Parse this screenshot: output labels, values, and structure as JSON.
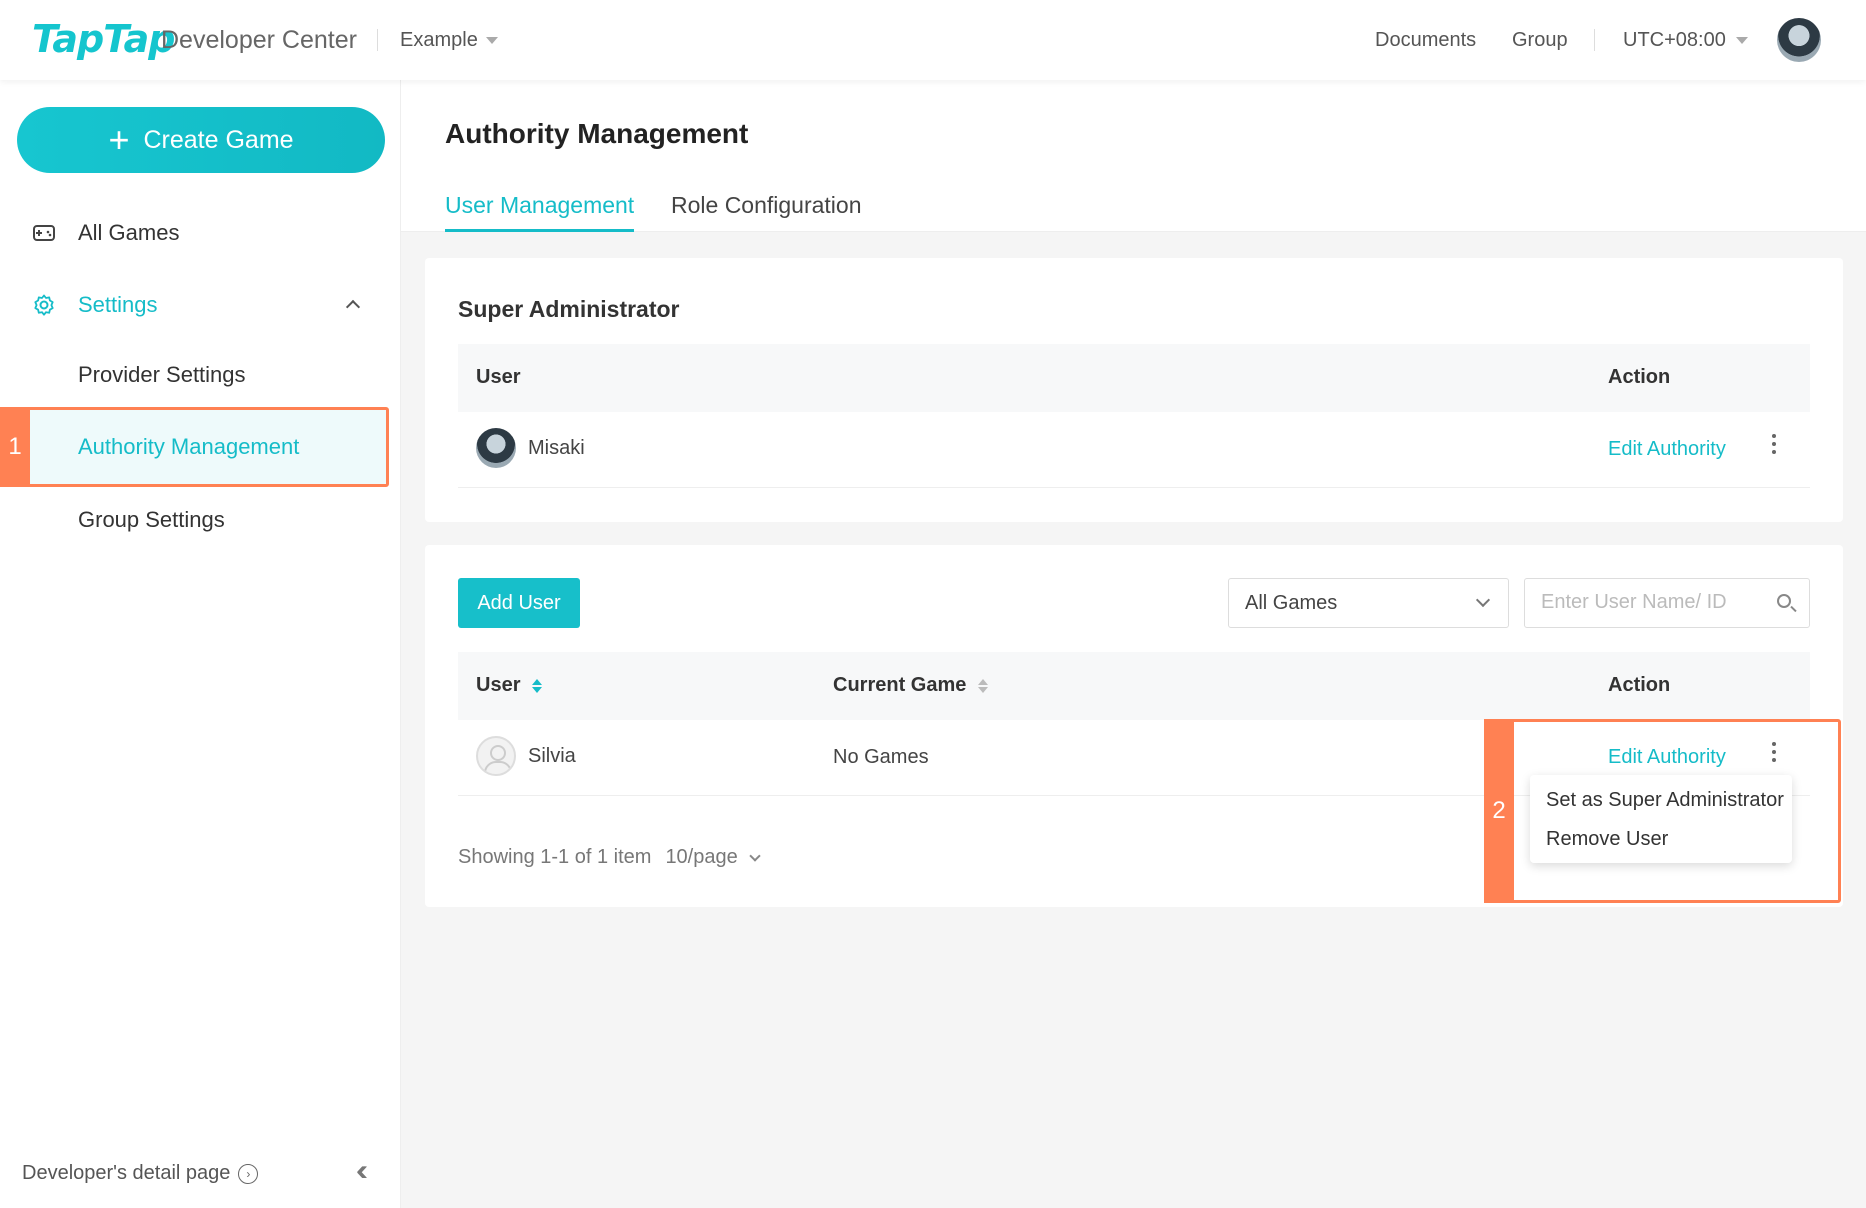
{
  "header": {
    "logo": "TapTap",
    "logo_sub": "Developer Center",
    "project": "Example",
    "links": [
      "Documents",
      "Group"
    ],
    "timezone": "UTC+08:00"
  },
  "sidebar": {
    "create_label": "Create Game",
    "items": [
      {
        "label": "All Games",
        "icon": "gamepad-icon"
      },
      {
        "label": "Settings",
        "icon": "gear-icon"
      },
      {
        "label": "Provider Settings"
      },
      {
        "label": "Authority Management"
      },
      {
        "label": "Group Settings"
      }
    ],
    "footer": "Developer's detail page",
    "badge1": "1"
  },
  "main": {
    "title": "Authority Management",
    "tabs": [
      "User Management",
      "Role Configuration"
    ],
    "super_admin": {
      "title": "Super Administrator",
      "columns": [
        "User",
        "Action"
      ],
      "rows": [
        {
          "user": "Misaki",
          "action": "Edit Authority"
        }
      ]
    },
    "users": {
      "add_label": "Add User",
      "filter_value": "All Games",
      "search_placeholder": "Enter User Name/ ID",
      "columns": [
        "User",
        "Current Game",
        "Action"
      ],
      "rows": [
        {
          "user": "Silvia",
          "game": "No Games",
          "action": "Edit Authority"
        }
      ],
      "pager_text": "Showing 1-1 of 1 item",
      "page_size": "10/page"
    },
    "menu": [
      "Set as Super Administrator",
      "Remove User"
    ],
    "badge2": "2"
  },
  "colors": {
    "accent": "#15bcc8",
    "highlight": "#ff8153"
  }
}
